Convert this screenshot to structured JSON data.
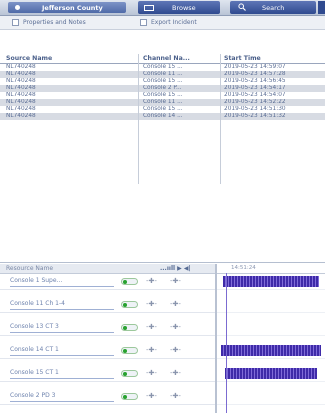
{
  "header": {
    "county_tab": "Jefferson County",
    "browse_tab": "Browse",
    "search_tab": "Search"
  },
  "toolbar": {
    "properties_label": "Properties and Notes",
    "export_label": "Export Incident"
  },
  "grid": {
    "columns": [
      "Source Name",
      "Channel Na...",
      "Start Time"
    ],
    "rows": [
      [
        "NL740248",
        "Console 15 ...",
        "2019-05-23 14:59:07"
      ],
      [
        "NL740248",
        "Console 11 ...",
        "2019-05-23 14:57:28"
      ],
      [
        "NL740248",
        "Console 15 ...",
        "2019-05-23 14:56:45"
      ],
      [
        "NL740248",
        "Console 2 P...",
        "2019-05-23 14:54:17"
      ],
      [
        "NL740248",
        "Console 15 ...",
        "2019-05-23 14:54:07"
      ],
      [
        "NL740248",
        "Console 11 ...",
        "2019-05-23 14:52:22"
      ],
      [
        "NL740248",
        "Console 15 ...",
        "2019-05-23 14:51:30"
      ],
      [
        "NL740248",
        "Console 14 ...",
        "2019-05-23 14:51:32"
      ]
    ]
  },
  "channels_panel": {
    "header_label": "Resource Name",
    "header_control": "...ııll ▶ ◀|",
    "timeline_label": "14:51:24"
  },
  "channels": [
    {
      "name": "Console 1 Supe...",
      "active": true
    },
    {
      "name": "Console 11 Ch 1-4",
      "active": true
    },
    {
      "name": "Console 13 CT 3",
      "active": true
    },
    {
      "name": "Console 14 CT 1",
      "active": true
    },
    {
      "name": "Console 15 CT 1",
      "active": true
    },
    {
      "name": "Console 2 PD 3",
      "active": true
    }
  ],
  "icons": {
    "county": "radio-dot-icon",
    "browse": "browse-icon",
    "search": "search-icon",
    "volume": "volume-slider-icon",
    "pan": "pan-slider-icon"
  },
  "colors": {
    "header_blue": "#2f4a8f",
    "row_alt": "#d7dbe3",
    "waveform": "#3e2aa8",
    "toggle_green": "#27a22e"
  }
}
